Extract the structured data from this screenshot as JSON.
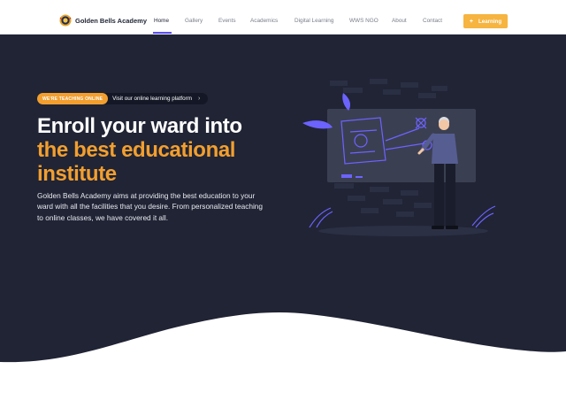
{
  "brand": {
    "name": "Golden Bells Academy"
  },
  "nav": {
    "items": [
      {
        "label": "Home",
        "active": true
      },
      {
        "label": "Gallery",
        "active": false
      },
      {
        "label": "Events",
        "active": false
      },
      {
        "label": "Academics",
        "active": false
      },
      {
        "label": "Digital Learning",
        "active": false
      },
      {
        "label": "WWS NGO",
        "active": false
      },
      {
        "label": "About",
        "active": false
      },
      {
        "label": "Contact",
        "active": false
      }
    ],
    "cta_label": "Learning",
    "cta_icon": "plus-icon"
  },
  "hero": {
    "badge": "WE'RE TEACHING ONLINE",
    "pill_text": "Visit our online learning platform",
    "pill_icon": "chevron-right-icon",
    "headline_line1": "Enroll your ward into",
    "headline_line2": "the best educational",
    "headline_line3": "institute",
    "lead": "Golden Bells Academy aims at providing the best education to your ward with all the facilities that you desire. From personalized teaching to online classes, we have covered it all."
  },
  "colors": {
    "nav_bg": "#ffffff",
    "hero_bg": "#202435",
    "accent_orange": "#f29f2f",
    "cta_yellow": "#f6b440",
    "active_underline": "#5b4ff0",
    "illustration_purple": "#6c63ff"
  }
}
